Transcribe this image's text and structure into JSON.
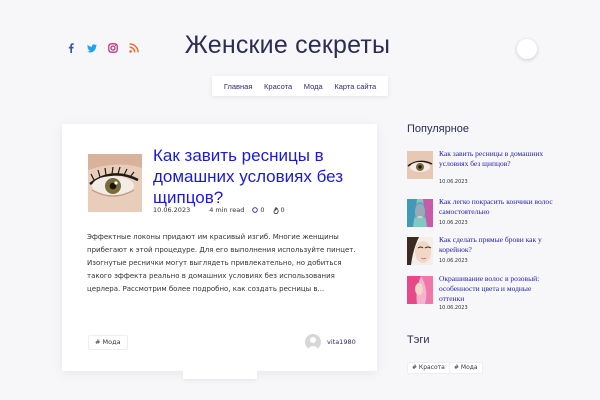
{
  "site": {
    "title": "Женские секреты"
  },
  "social": [
    "facebook-icon",
    "twitter-icon",
    "instagram-icon",
    "rss-icon"
  ],
  "colors": {
    "link": "#1a1ad9",
    "title": "#2c2c54",
    "facebook": "#3b5998",
    "twitter": "#1da1f2",
    "instagram": "#c13584",
    "rss": "#f26522"
  },
  "nav": {
    "items": [
      "Главная",
      "Красота",
      "Мода",
      "Карта сайта"
    ]
  },
  "post": {
    "title": "Как завить ресницы в домашних условиях без щипцов?",
    "date": "10.06.2023",
    "read_time": "4 min read",
    "comments": "0",
    "likes": "0",
    "excerpt": "Эффектные локоны придают им красивый изгиб. Многие женщины прибегают к этой процедуре. Для его выполнения используйте пинцет. Изогнутые реснички могут выглядеть привлекательно, но добиться такого эффекта реально в домашних условиях без использования церлера. Рассмотрим более подробно, как создать ресницы в...",
    "tag": "# Мода",
    "author": "vita1980"
  },
  "sidebar": {
    "popular_heading": "Популярное",
    "popular": [
      {
        "title": "Как завить ресницы в домашних условиях без щипцов?",
        "date": "10.06.2023"
      },
      {
        "title": "Как легко покрасить кончики волос самостоятельно",
        "date": "10.06.2023"
      },
      {
        "title": "Как сделать прямые брови как у корейнок?",
        "date": "10.06.2023"
      },
      {
        "title": "Окрашивание волос в розовый: особенности цвета и модные оттенки",
        "date": "10.06.2023"
      }
    ],
    "tags_heading": "Тэги",
    "tags": [
      "# Красота",
      "# Мода"
    ]
  }
}
